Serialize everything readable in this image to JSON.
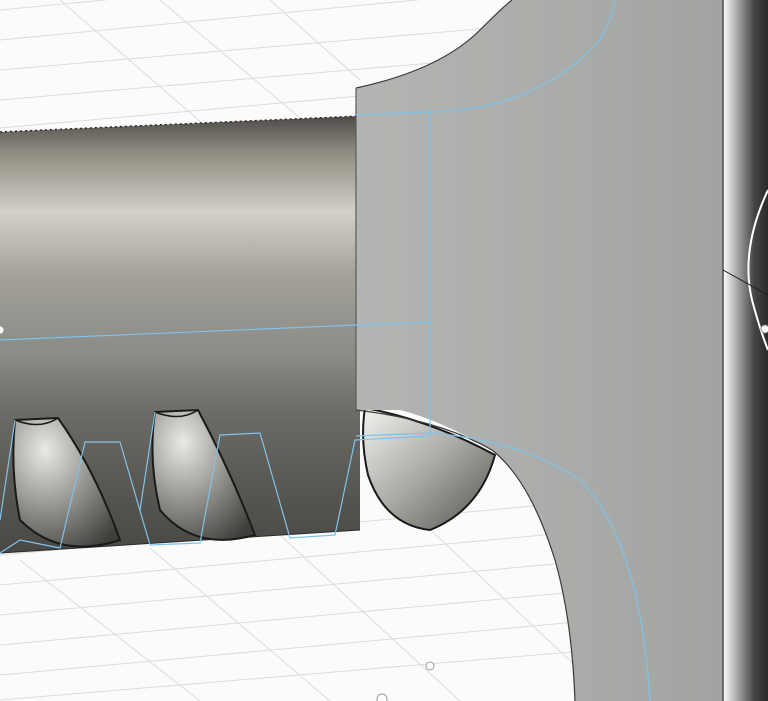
{
  "viewport": {
    "kind": "3d-model-viewport",
    "background_color": "#fbfbfb",
    "grid_color": "#d9dcdf",
    "body_color": "#a9aba8",
    "shaft_color": "#7d7b74",
    "sketch_line_color": "#7ec3ea",
    "edge_color": "#1f1f1f"
  }
}
